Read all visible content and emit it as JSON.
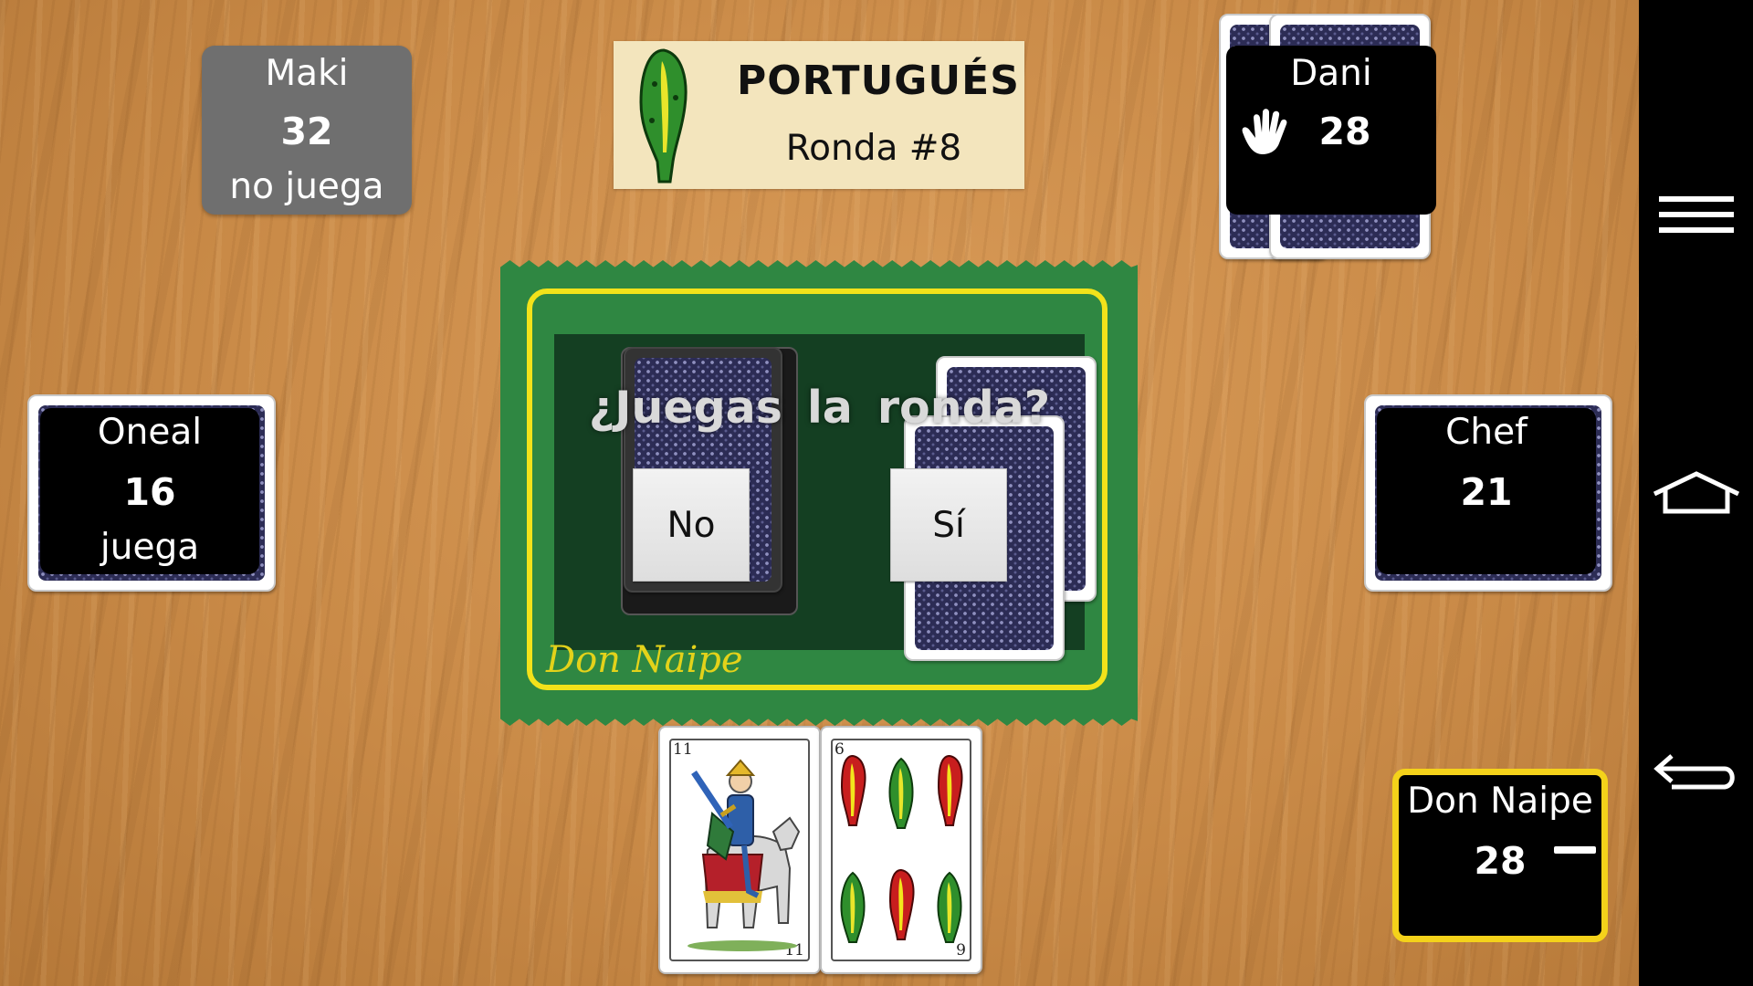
{
  "game": {
    "title": "PORTUGUÉS",
    "round": "Ronda #8",
    "question": "¿Juegas la ronda?",
    "btn_no": "No",
    "btn_yes": "Sí",
    "mat_brand": "Don Naipe",
    "trump_suit": "bastos",
    "colors": {
      "mat_green": "#2f8742",
      "mat_border": "#f2e21a",
      "active_highlight": "#f4d21a",
      "panel_inactive": "#6f6f6f"
    }
  },
  "players": {
    "maki": {
      "name": "Maki",
      "score": "32",
      "status": "no juega"
    },
    "dani": {
      "name": "Dani",
      "score": "28",
      "icon": "hand-icon"
    },
    "oneal": {
      "name": "Oneal",
      "score": "16",
      "status": "juega"
    },
    "chef": {
      "name": "Chef",
      "score": "21"
    },
    "self": {
      "name": "Don Naipe",
      "score": "28"
    }
  },
  "hand": [
    {
      "rank": "11",
      "suit": "espadas",
      "figure": "caballo"
    },
    {
      "rank": "6",
      "suit": "bastos"
    }
  ],
  "navbar": {
    "icons": [
      "menu-icon",
      "home-icon",
      "back-icon"
    ]
  }
}
